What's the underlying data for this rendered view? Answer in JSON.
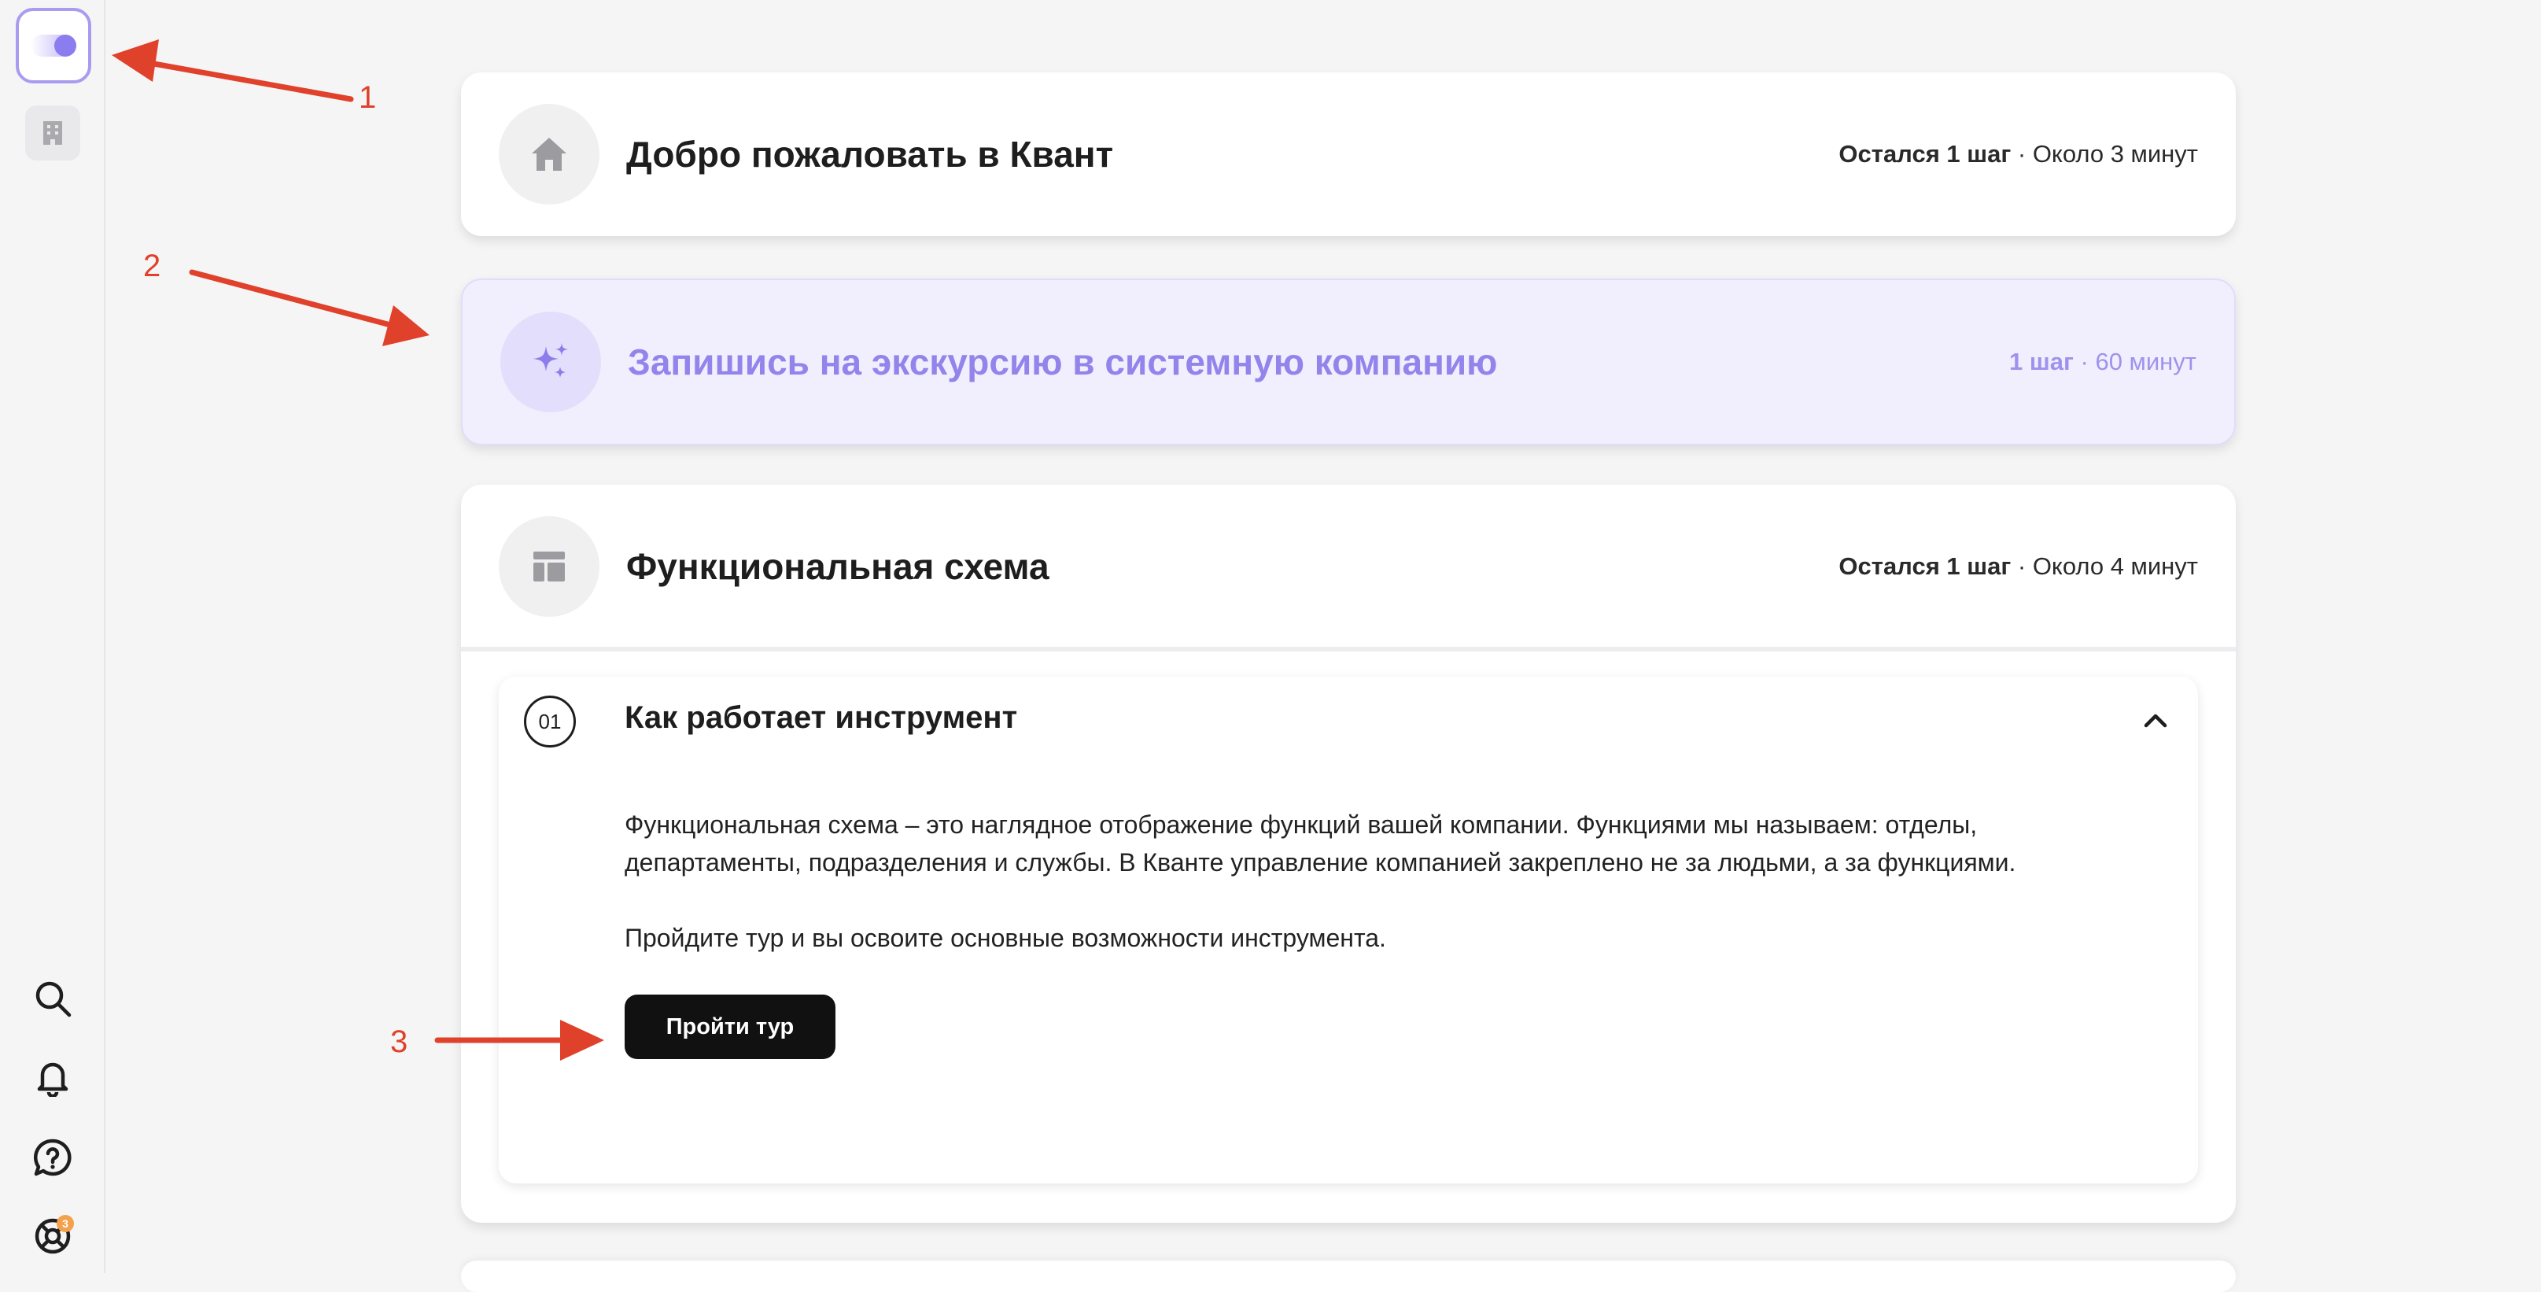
{
  "sidebar": {
    "toggle_icon": "toggle-icon",
    "building_icon": "building-icon",
    "bottom_icons": [
      "search-icon",
      "bell-icon",
      "help-icon",
      "lifebuoy-icon"
    ],
    "notification_badge": "3"
  },
  "cards": [
    {
      "icon": "home-icon",
      "title": "Добро пожаловать в Квант",
      "meta_bold": "Остался 1 шаг",
      "meta_rest": " · Около 3 минут"
    },
    {
      "icon": "sparkle-icon",
      "title": "Запишись на экскурсию в системную компанию",
      "meta_bold": "1 шаг",
      "meta_rest": " · 60 минут"
    },
    {
      "icon": "layout-icon",
      "title": "Функциональная схема",
      "meta_bold": "Остался 1 шаг",
      "meta_rest": " · Около 4 минут",
      "step": {
        "number": "01",
        "title": "Как работает инструмент",
        "description": "Функциональная схема – это наглядное отображение функций вашей компании. Функциями мы называем: отделы, департаменты, подразделения и службы. В Кванте управление компанией закреплено не за людьми, а за функциями.",
        "description2": "Пройдите тур и вы освоите основные возможности инструмента.",
        "button_label": "Пройти тур"
      }
    }
  ],
  "annotations": [
    "1",
    "2",
    "3"
  ],
  "colors": {
    "accent": "#9384ec",
    "annotation": "#e0412a",
    "button": "#111111"
  }
}
